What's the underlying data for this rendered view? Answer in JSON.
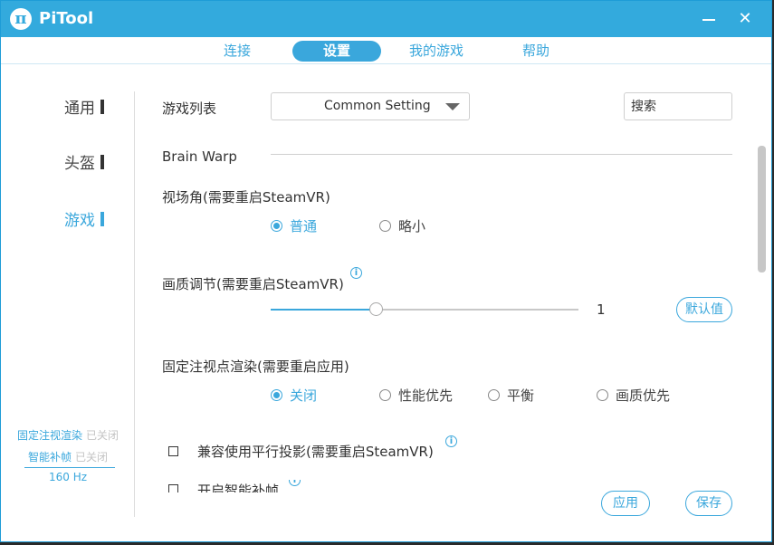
{
  "app": {
    "logo": "π",
    "title": "PiTool",
    "minimize_icon": "minimize-icon",
    "close_icon": "close-icon",
    "close_glyph": "✕"
  },
  "colors": {
    "accent": "#3aa7dc",
    "titlebar": "#33aadd"
  },
  "tabs": [
    {
      "label": "连接",
      "active": false
    },
    {
      "label": "设置",
      "active": true
    },
    {
      "label": "我的游戏",
      "active": false
    },
    {
      "label": "帮助",
      "active": false
    }
  ],
  "sidebar": {
    "items": [
      {
        "label": "通用",
        "active": false
      },
      {
        "label": "头盔",
        "active": false
      },
      {
        "label": "游戏",
        "active": true
      }
    ],
    "status": [
      {
        "label": "固定注视渲染",
        "value": "已关闭"
      },
      {
        "label": "智能补帧",
        "value": "已关闭"
      }
    ],
    "refresh_rate": "160 Hz"
  },
  "settings": {
    "game_list_label": "游戏列表",
    "game_list_value": "Common Setting",
    "search_placeholder": "搜索",
    "section_title": "Brain Warp",
    "fov": {
      "label": "视场角(需要重启SteamVR)",
      "options": [
        "普通",
        "略小"
      ],
      "selected": 0
    },
    "quality": {
      "label": "画质调节(需要重启SteamVR)",
      "info_icon": "info-icon",
      "value": "1",
      "slider_fraction": 0.34,
      "reset_label": "默认值"
    },
    "foveated": {
      "label": "固定注视点渲染(需要重启应用)",
      "options": [
        "关闭",
        "性能优先",
        "平衡",
        "画质优先"
      ],
      "selected": 0
    },
    "parallel_projection": {
      "label": "兼容使用平行投影(需要重启SteamVR)",
      "checked": false
    },
    "smart_frame": {
      "label": "开启智能补帧",
      "checked": false
    }
  },
  "footer": {
    "apply_label": "应用",
    "save_label": "保存"
  }
}
